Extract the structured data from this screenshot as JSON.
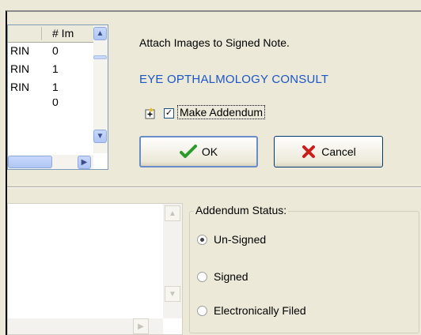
{
  "list": {
    "header_col2": "# Im",
    "rows": [
      {
        "c1": "RIN",
        "c2": "0"
      },
      {
        "c1": "RIN",
        "c2": "1"
      },
      {
        "c1": "RIN",
        "c2": "1"
      },
      {
        "c1": "",
        "c2": "0"
      }
    ]
  },
  "attach_label": "Attach Images to Signed Note.",
  "note_title": "EYE OPTHALMOLOGY CONSULT",
  "make_addendum": {
    "label": "Make Addendum",
    "checked": true
  },
  "buttons": {
    "ok": "OK",
    "cancel": "Cancel"
  },
  "addendum_status": {
    "title": "Addendum Status:",
    "options": [
      {
        "label": "Un-Signed",
        "selected": true
      },
      {
        "label": "Signed",
        "selected": false
      },
      {
        "label": "Electronically Filed",
        "selected": false
      }
    ]
  },
  "colors": {
    "ok_check": "#2a9b2a",
    "cancel_x": "#c81e1e",
    "note_title": "#1a56c8"
  }
}
